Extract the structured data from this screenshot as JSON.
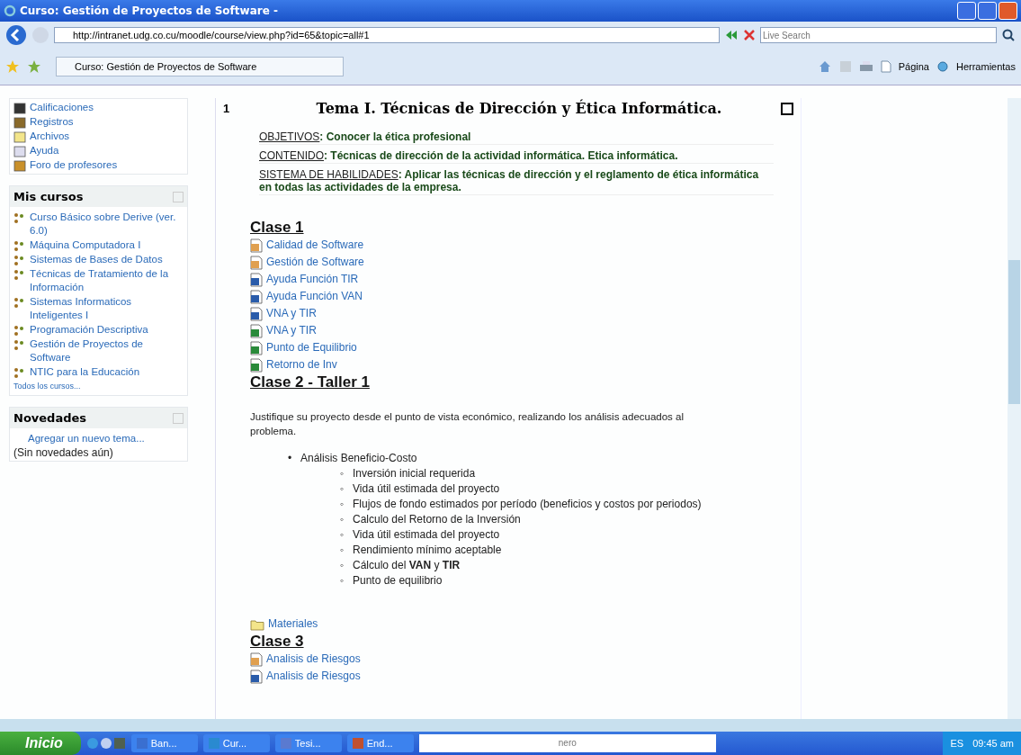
{
  "window": {
    "title": "Curso: Gestión de Proyectos de Software -"
  },
  "address_bar": {
    "url": "http://intranet.udg.co.cu/moodle/course/view.php?id=65&topic=all#1",
    "search_placeholder": "Live Search"
  },
  "tab": {
    "label": "Curso: Gestión de Proyectos de Software",
    "selected": true
  },
  "command_bar": [
    {
      "label": "Página",
      "kind": "page"
    },
    {
      "label": "Herramientas",
      "kind": "tools"
    }
  ],
  "sidebar": {
    "admin_items": [
      {
        "label": "Calificaciones",
        "kind": "grades"
      },
      {
        "label": "Registros",
        "kind": "logs"
      },
      {
        "label": "Archivos",
        "kind": "folder"
      },
      {
        "label": "Ayuda",
        "kind": "help"
      },
      {
        "label": "Foro de profesores",
        "kind": "forum"
      }
    ],
    "my_courses": {
      "title": "Mis cursos",
      "items": [
        "Curso Básico sobre Derive (ver. 6.0)",
        "Máquina Computadora I",
        "Sistemas de Bases de Datos",
        "Técnicas de Tratamiento de la Información",
        "Sistemas Informaticos Inteligentes I",
        "Programación Descriptiva",
        "Gestión de Proyectos de Software",
        "NTIC para la Educación"
      ],
      "all_link": "Todos los cursos..."
    },
    "news": {
      "title": "Novedades",
      "add_link": "Agregar un nuevo tema...",
      "empty": "(Sin novedades aún)"
    }
  },
  "topic": {
    "number": "1",
    "title": "Tema I. Técnicas de Dirección y Ética Informática.",
    "summary": [
      {
        "label": "OBJETIVOS",
        "text": ": Conocer la ética profesional"
      },
      {
        "label": "CONTENIDO",
        "text": ": Técnicas de dirección de la actividad informática. Etica informática."
      },
      {
        "label": "SISTEMA DE HABILIDADES",
        "text": ": Aplicar las técnicas de dirección y el reglamento de ética informática en todas las actividades de la empresa."
      }
    ],
    "blocks": [
      {
        "kind": "heading",
        "text": "Clase 1"
      },
      {
        "kind": "slides",
        "text": "Calidad de Software"
      },
      {
        "kind": "slides",
        "text": "Gestión de Software"
      },
      {
        "kind": "word",
        "text": "Ayuda Función TIR"
      },
      {
        "kind": "word",
        "text": "Ayuda Función VAN"
      },
      {
        "kind": "word",
        "text": "VNA y TIR"
      },
      {
        "kind": "excel",
        "text": "VNA y TIR"
      },
      {
        "kind": "excel",
        "text": "Punto de Equilibrio"
      },
      {
        "kind": "excel",
        "text": "Retorno de Inv"
      },
      {
        "kind": "heading",
        "text": "Clase 2 - Taller 1"
      },
      {
        "kind": "paragraph",
        "text": "Justifique su proyecto desde el punto de vista económico, realizando los análisis adecuados al problema."
      },
      {
        "kind": "list",
        "items": [
          {
            "marker": "•",
            "text": "Análisis Beneficio-Costo",
            "children": [
              {
                "marker": "◦",
                "text": "Inversión inicial requerida"
              },
              {
                "marker": "◦",
                "text": "Vida útil estimada del proyecto"
              },
              {
                "marker": "◦",
                "text": "Flujos de fondo estimados por período (beneficios y costos por periodos)"
              },
              {
                "marker": "◦",
                "text": "Calculo del Retorno de la Inversión"
              },
              {
                "marker": "◦",
                "text": "Vida útil estimada del proyecto"
              },
              {
                "marker": "◦",
                "text": "Rendimiento mínimo aceptable"
              },
              {
                "marker": "◦",
                "text": "Cálculo del **VAN** y **TIR**"
              },
              {
                "marker": "◦",
                "text": "Punto de equilibrio"
              }
            ]
          }
        ]
      },
      {
        "kind": "folder",
        "text": "Materiales"
      },
      {
        "kind": "heading",
        "text": "Clase 3"
      },
      {
        "kind": "slides",
        "text": "Analisis de Riesgos"
      },
      {
        "kind": "word",
        "text": "Analisis de Riesgos"
      }
    ]
  },
  "taskbar": {
    "start": "Inicio",
    "tasks": [
      {
        "label": "Ban...",
        "kind": "window"
      },
      {
        "label": "Cur...",
        "kind": "browser"
      },
      {
        "label": "Tesi...",
        "kind": "doc"
      },
      {
        "label": "End...",
        "kind": "app"
      }
    ],
    "deskband": "nero",
    "language": "ES",
    "clock": "09:45 am"
  }
}
